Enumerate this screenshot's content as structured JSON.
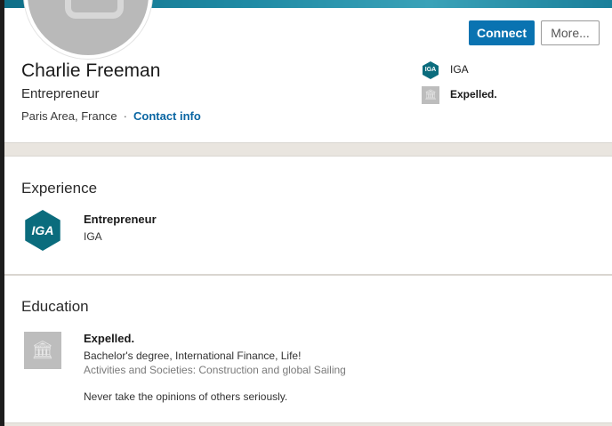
{
  "profile": {
    "name": "Charlie Freeman",
    "headline": "Entrepreneur",
    "location": "Paris Area, France",
    "separator": "·",
    "contact_info": "Contact info"
  },
  "actions": {
    "connect_label": "Connect",
    "more_label": "More..."
  },
  "side_summary": {
    "company": {
      "label": "IGA",
      "logo_text": "IGA",
      "icon": "iga-logo-icon"
    },
    "school": {
      "label": "Expelled.",
      "icon": "school-building-icon"
    }
  },
  "experience": {
    "heading": "Experience",
    "items": [
      {
        "title": "Entrepreneur",
        "company": "IGA",
        "logo_text": "IGA"
      }
    ]
  },
  "education": {
    "heading": "Education",
    "items": [
      {
        "school": "Expelled.",
        "degree": "Bachelor's degree, International Finance, Life!",
        "activities": "Activities and Societies: Construction and global Sailing",
        "description": "Never take the opinions of others seriously."
      }
    ]
  },
  "colors": {
    "accent": "#0a73b1",
    "link": "#0a66a3",
    "iga_teal": "#0b6c7d"
  }
}
